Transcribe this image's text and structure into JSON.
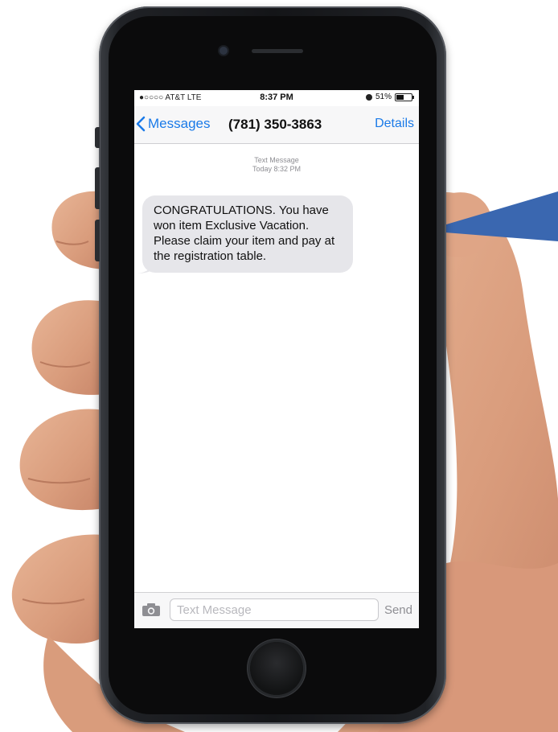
{
  "status_bar": {
    "carrier": "●○○○○ AT&T  LTE",
    "time": "8:37 PM",
    "battery": "51%",
    "battery_level": 0.51
  },
  "nav": {
    "back_label": "Messages",
    "contact": "(781) 350-3863",
    "details_label": "Details"
  },
  "thread": {
    "message_type": "Text Message",
    "timestamp": "Today 8:32 PM",
    "messages": [
      {
        "direction": "incoming",
        "text": "CONGRATULATIONS.  You have won item Exclusive Vacation. Please claim your item and pay at the registration table."
      }
    ]
  },
  "input_bar": {
    "placeholder": "Text Message",
    "send_label": "Send",
    "camera_icon": "camera-icon"
  },
  "colors": {
    "accent": "#1a7ae8",
    "bubble": "#e6e6ea",
    "pointer": "#3a67b0"
  }
}
